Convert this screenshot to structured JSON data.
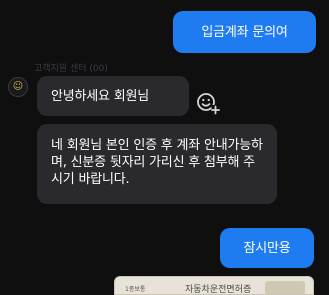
{
  "messages": {
    "out_1": "입금계좌 문의여",
    "sender_name": "고객지원 센터 (00)",
    "in_1": "안녕하세요 회원님",
    "in_2": "네 회원님 본인 인증 후 계좌 안내가능하며, 신분증 뒷자리 가리신 후 첨부해 주시기 바랍니다.",
    "out_2": "잠시만용"
  },
  "attachment": {
    "tag": "1종보통",
    "title": "자동차운전면허증"
  },
  "icons": {
    "avatar": "avatar-icon",
    "reaction": "add-reaction-icon"
  },
  "colors": {
    "outgoing_bubble": "#1f7cf0",
    "incoming_bubble": "#2a2a2e",
    "background": "#0f0f10"
  }
}
